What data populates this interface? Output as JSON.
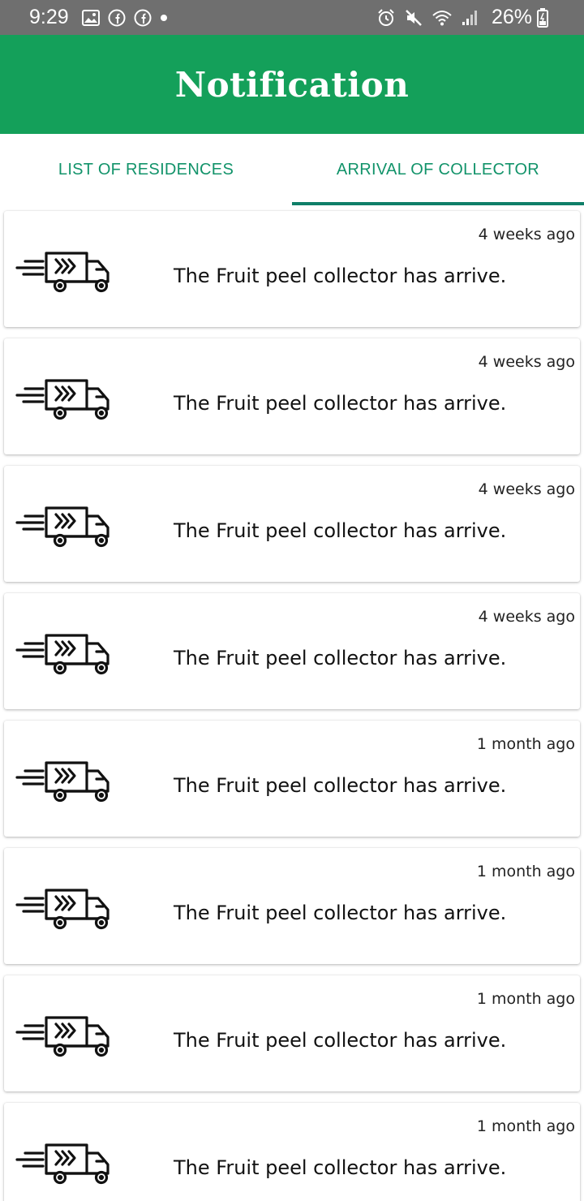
{
  "status_bar": {
    "time": "9:29",
    "battery": "26%",
    "icons": [
      "image-icon",
      "facebook-icon",
      "facebook-icon",
      "dot-icon",
      "alarm-icon",
      "mute-icon",
      "wifi-icon",
      "signal-icon",
      "battery-icon"
    ]
  },
  "app_bar": {
    "title": "Notification",
    "color": "#14a05a"
  },
  "tabs": [
    {
      "label": "LIST OF RESIDENCES",
      "active": false
    },
    {
      "label": "ARRIVAL OF COLLECTOR",
      "active": true
    }
  ],
  "notifications": [
    {
      "time": "4 weeks ago",
      "message": "The Fruit peel collector has arrive.",
      "icon": "truck-icon"
    },
    {
      "time": "4 weeks ago",
      "message": "The Fruit peel collector has arrive.",
      "icon": "truck-icon"
    },
    {
      "time": "4 weeks ago",
      "message": "The Fruit peel collector has arrive.",
      "icon": "truck-icon"
    },
    {
      "time": "4 weeks ago",
      "message": "The Fruit peel collector has arrive.",
      "icon": "truck-icon"
    },
    {
      "time": "1 month ago",
      "message": "The Fruit peel collector has arrive.",
      "icon": "truck-icon"
    },
    {
      "time": "1 month ago",
      "message": "The Fruit peel collector has arrive.",
      "icon": "truck-icon"
    },
    {
      "time": "1 month ago",
      "message": "The Fruit peel collector has arrive.",
      "icon": "truck-icon"
    },
    {
      "time": "1 month ago",
      "message": "The Fruit peel collector has arrive.",
      "icon": "truck-icon"
    }
  ]
}
